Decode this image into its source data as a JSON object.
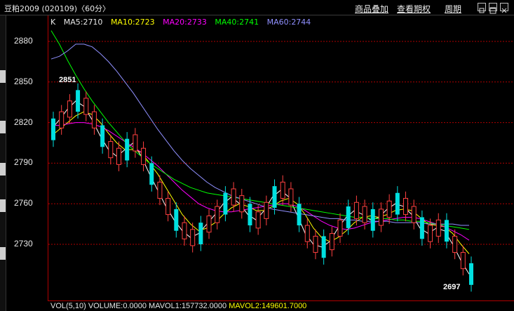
{
  "window": {
    "title": "豆粕2009 (020109)〈60分〉",
    "menus": [
      "商品叠加",
      "查看期权",
      "周期"
    ],
    "buttons": [
      "restore-icon",
      "maximize-icon",
      "close-icon"
    ]
  },
  "legend": {
    "k": "K",
    "ma5": "MA5:2710",
    "ma10": "MA10:2723",
    "ma20": "MA20:2733",
    "ma40": "MA40:2741",
    "ma60": "MA60:2744",
    "colors": {
      "ma5": "#ffffff",
      "ma10": "#ffff00",
      "ma20": "#ff00ff",
      "ma40": "#00ff00",
      "ma60": "#9090ff"
    }
  },
  "annotations": {
    "high": "2851",
    "low": "2697"
  },
  "volume": {
    "label": "VOL(5,10)",
    "volume": "VOLUME:0.0000",
    "mavol1": "MAVOL1:157732.0000",
    "mavol2": "MAVOL2:149601.7000"
  },
  "chart_data": {
    "type": "line",
    "ylim": [
      2700,
      2895
    ],
    "yticks": [
      2880,
      2850,
      2820,
      2790,
      2760,
      2730
    ],
    "grid": true,
    "series": [
      {
        "name": "MA5",
        "color": "#ffffff",
        "values": [
          2815,
          2822,
          2830,
          2836,
          2832,
          2822,
          2810,
          2800,
          2795,
          2800,
          2805,
          2795,
          2782,
          2770,
          2758,
          2748,
          2740,
          2735,
          2738,
          2745,
          2752,
          2760,
          2765,
          2760,
          2752,
          2748,
          2755,
          2765,
          2770,
          2765,
          2752,
          2738,
          2730,
          2728,
          2732,
          2742,
          2750,
          2755,
          2752,
          2748,
          2750,
          2756,
          2760,
          2758,
          2752,
          2742,
          2738,
          2742,
          2740,
          2730,
          2718,
          2708
        ]
      },
      {
        "name": "MA10",
        "color": "#ffff00",
        "values": [
          2810,
          2815,
          2820,
          2825,
          2828,
          2826,
          2820,
          2812,
          2805,
          2800,
          2800,
          2798,
          2790,
          2782,
          2772,
          2762,
          2752,
          2745,
          2740,
          2742,
          2746,
          2752,
          2757,
          2760,
          2758,
          2755,
          2755,
          2758,
          2762,
          2764,
          2760,
          2752,
          2742,
          2735,
          2732,
          2735,
          2740,
          2746,
          2750,
          2751,
          2750,
          2752,
          2755,
          2756,
          2755,
          2750,
          2745,
          2744,
          2743,
          2738,
          2730,
          2723
        ]
      },
      {
        "name": "MA20",
        "color": "#ff00ff",
        "values": [
          2818,
          2818,
          2819,
          2820,
          2820,
          2819,
          2817,
          2814,
          2810,
          2806,
          2802,
          2798,
          2793,
          2788,
          2782,
          2776,
          2770,
          2765,
          2760,
          2757,
          2755,
          2754,
          2754,
          2755,
          2756,
          2757,
          2758,
          2759,
          2760,
          2760,
          2758,
          2755,
          2751,
          2747,
          2744,
          2742,
          2741,
          2742,
          2744,
          2746,
          2747,
          2748,
          2749,
          2750,
          2750,
          2749,
          2747,
          2745,
          2743,
          2740,
          2737,
          2733
        ]
      },
      {
        "name": "MA40",
        "color": "#00ff00",
        "values": [
          2888,
          2878,
          2866,
          2855,
          2845,
          2836,
          2828,
          2820,
          2813,
          2806,
          2800,
          2795,
          2790,
          2786,
          2782,
          2778,
          2775,
          2772,
          2770,
          2768,
          2767,
          2766,
          2765,
          2764,
          2763,
          2762,
          2761,
          2760,
          2759,
          2758,
          2757,
          2756,
          2755,
          2754,
          2753,
          2752,
          2751,
          2750,
          2750,
          2749,
          2749,
          2749,
          2748,
          2748,
          2747,
          2747,
          2746,
          2745,
          2744,
          2743,
          2742,
          2741
        ]
      },
      {
        "name": "MA60",
        "color": "#9090ff",
        "values": [
          2867,
          2869,
          2873,
          2878,
          2878,
          2876,
          2871,
          2865,
          2858,
          2850,
          2842,
          2833,
          2824,
          2815,
          2807,
          2799,
          2792,
          2786,
          2781,
          2776,
          2772,
          2769,
          2766,
          2764,
          2762,
          2760,
          2758,
          2756,
          2755,
          2754,
          2753,
          2752,
          2751,
          2750,
          2749,
          2749,
          2748,
          2748,
          2747,
          2747,
          2747,
          2747,
          2746,
          2746,
          2746,
          2746,
          2745,
          2745,
          2745,
          2745,
          2744,
          2744
        ]
      }
    ]
  }
}
